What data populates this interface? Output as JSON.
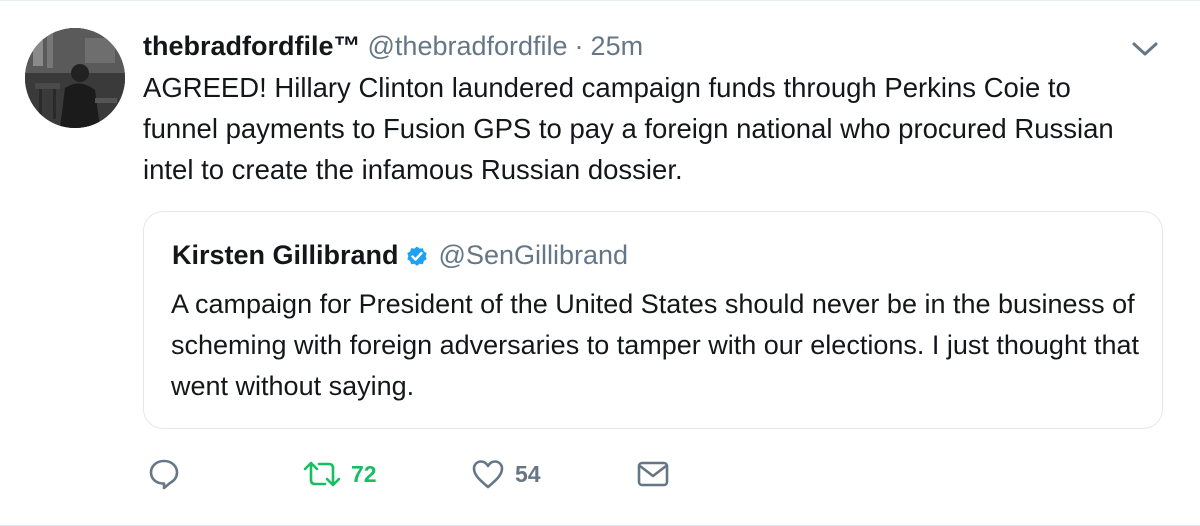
{
  "tweet": {
    "display_name": "thebradfordfile™",
    "handle": "@thebradfordfile",
    "separator": "·",
    "time": "25m",
    "text": "AGREED! Hillary Clinton laundered campaign funds through Perkins Coie to funnel payments to Fusion GPS to pay a foreign national who procured Russian intel to create the infamous Russian dossier.",
    "avatar_icon": "profile-photo"
  },
  "quoted_tweet": {
    "display_name": "Kirsten Gillibrand",
    "verified": true,
    "handle": "@SenGillibrand",
    "text": "A campaign for President of the United States should never be in the business of scheming with foreign adversaries to tamper with our elections. I just thought that went without saying."
  },
  "actions": {
    "reply_icon": "speech-bubble-icon",
    "retweet_icon": "retweet-icon",
    "retweet_count": "72",
    "like_icon": "heart-icon",
    "like_count": "54",
    "dm_icon": "envelope-icon"
  },
  "colors": {
    "text": "#14171a",
    "secondary": "#657786",
    "retweet_green": "#17bf63",
    "verified_blue": "#1da1f2",
    "border": "#e1e8ed"
  }
}
